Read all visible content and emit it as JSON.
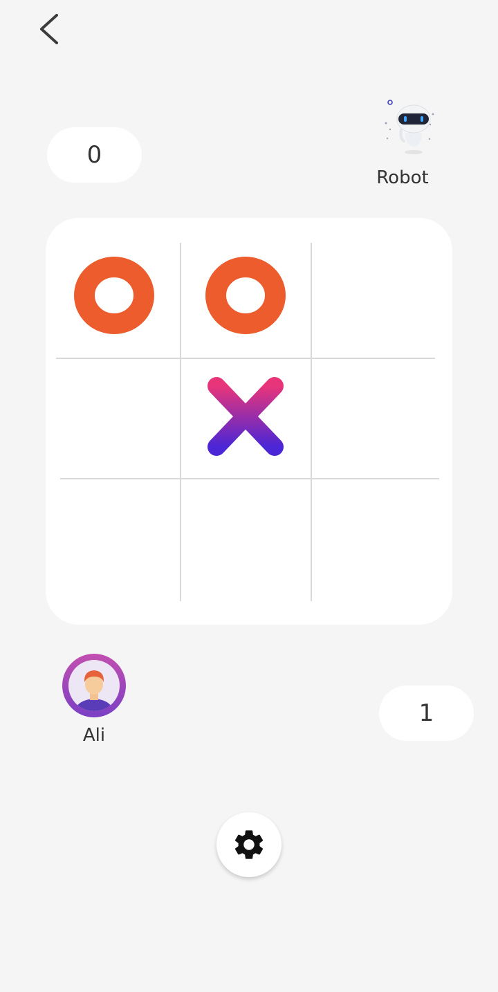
{
  "header": {
    "back_icon": "chevron-left-icon"
  },
  "opponent": {
    "name": "Robot",
    "score": "0",
    "avatar_icon": "robot-avatar-icon"
  },
  "player": {
    "name": "Ali",
    "score": "1",
    "avatar_icon": "user-avatar-icon"
  },
  "board": {
    "cells": [
      "O",
      "O",
      "",
      "",
      "X",
      "",
      "",
      "",
      ""
    ],
    "colors": {
      "o_mark": "#ec5c2c",
      "x_mark_top": "#e8357a",
      "x_mark_bottom": "#4a26d6",
      "grid_line": "#d9d9d9"
    }
  },
  "footer": {
    "settings_icon": "gear-icon"
  }
}
